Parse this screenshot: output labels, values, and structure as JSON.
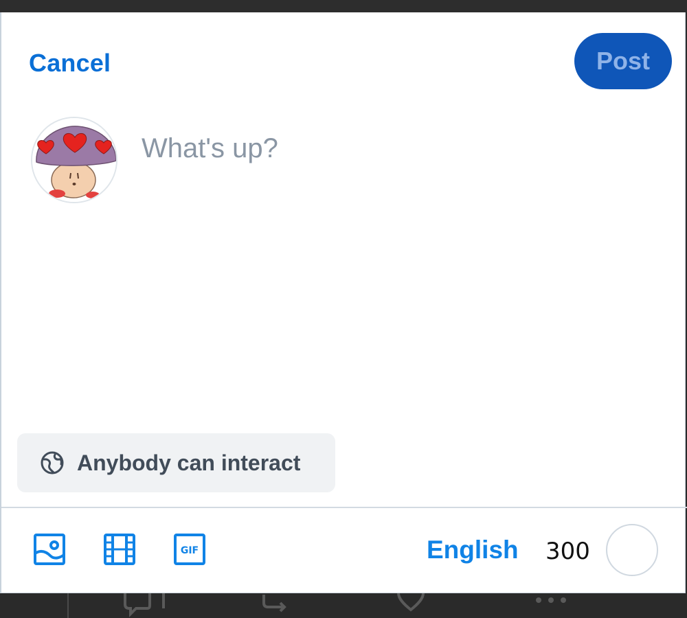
{
  "header": {
    "cancel_label": "Cancel",
    "post_label": "Post"
  },
  "compose": {
    "placeholder": "What's up?",
    "value": ""
  },
  "interaction": {
    "label": "Anybody can interact",
    "icon": "globe-icon"
  },
  "toolbar": {
    "icons": [
      "image-icon",
      "video-icon",
      "gif-icon"
    ],
    "language": "English",
    "char_remaining": "300"
  },
  "colors": {
    "accent": "#0a6fd6",
    "post_button": "#0f56b8",
    "post_text_disabled": "#8fb3e8",
    "pill_bg": "#f0f2f4",
    "placeholder": "#8a96a4"
  }
}
